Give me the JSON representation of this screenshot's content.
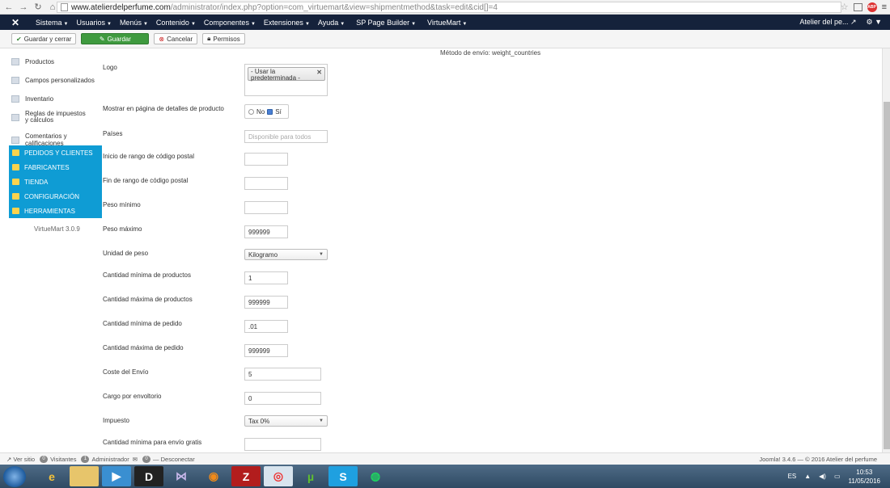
{
  "browser": {
    "url_host": "www.atelierdelperfume.com",
    "url_rest": "/administrator/index.php?option=com_virtuemart&view=shipmentmethod&task=edit&cid[]=4"
  },
  "topmenu": {
    "items": [
      "Sistema",
      "Usuarios",
      "Menús",
      "Contenido",
      "Componentes",
      "Extensiones",
      "Ayuda",
      "SP Page Builder",
      "VirtueMart"
    ],
    "site_name": "Atelier del pe..."
  },
  "toolbar": {
    "save_close": "Guardar y cerrar",
    "save": "Guardar",
    "cancel": "Cancelar",
    "permissions": "Permisos"
  },
  "sidebar": {
    "items": [
      "Productos",
      "Campos personalizados",
      "Inventario",
      "Reglas de impuestos y cálculos",
      "Comentarios y calificaciones"
    ],
    "sections": [
      "PEDIDOS Y CLIENTES",
      "FABRICANTES",
      "TIENDA",
      "CONFIGURACIÓN",
      "HERRAMIENTAS"
    ],
    "version": "VirtueMart 3.0.9"
  },
  "form": {
    "title": "Método de envío: weight_countries",
    "logo_label": "Logo",
    "logo_value": "- Usar la predeterminada -",
    "show_label": "Mostrar en página de detalles de producto",
    "no": "No",
    "si": "Sí",
    "countries_label": "Países",
    "countries_placeholder": "Disponible para todos",
    "zip_start_label": "Inicio de rango de código postal",
    "zip_end_label": "Fin de rango de código postal",
    "weight_min_label": "Peso mínimo",
    "weight_max_label": "Peso máximo",
    "weight_max_value": "999999",
    "weight_unit_label": "Unidad de peso",
    "weight_unit_value": "Kilogramo",
    "qty_min_label": "Cantidad mínima de productos",
    "qty_min_value": "1",
    "qty_max_label": "Cantidad máxima de productos",
    "qty_max_value": "999999",
    "order_min_label": "Cantidad mínima de pedido",
    "order_min_value": ".01",
    "order_max_label": "Cantidad máxima de pedido",
    "order_max_value": "999999",
    "ship_cost_label": "Coste del Envío",
    "ship_cost_value": "5",
    "pack_cost_label": "Cargo por envoltorio",
    "pack_cost_value": "0",
    "tax_label": "Impuesto",
    "tax_value": "Tax 0%",
    "free_min_label": "Cantidad mínima para envío gratis"
  },
  "status": {
    "view_site": "Ver sitio",
    "visitors_count": "0",
    "visitors": "Visitantes",
    "admin_count": "1",
    "admin": "Administrador",
    "messages_count": "0",
    "logout": "Desconectar",
    "footer": "Joomla! 3.4.6 — © 2016 Atelier del perfume"
  },
  "taskbar": {
    "lang": "ES",
    "time": "10:53",
    "date": "11/05/2016"
  }
}
